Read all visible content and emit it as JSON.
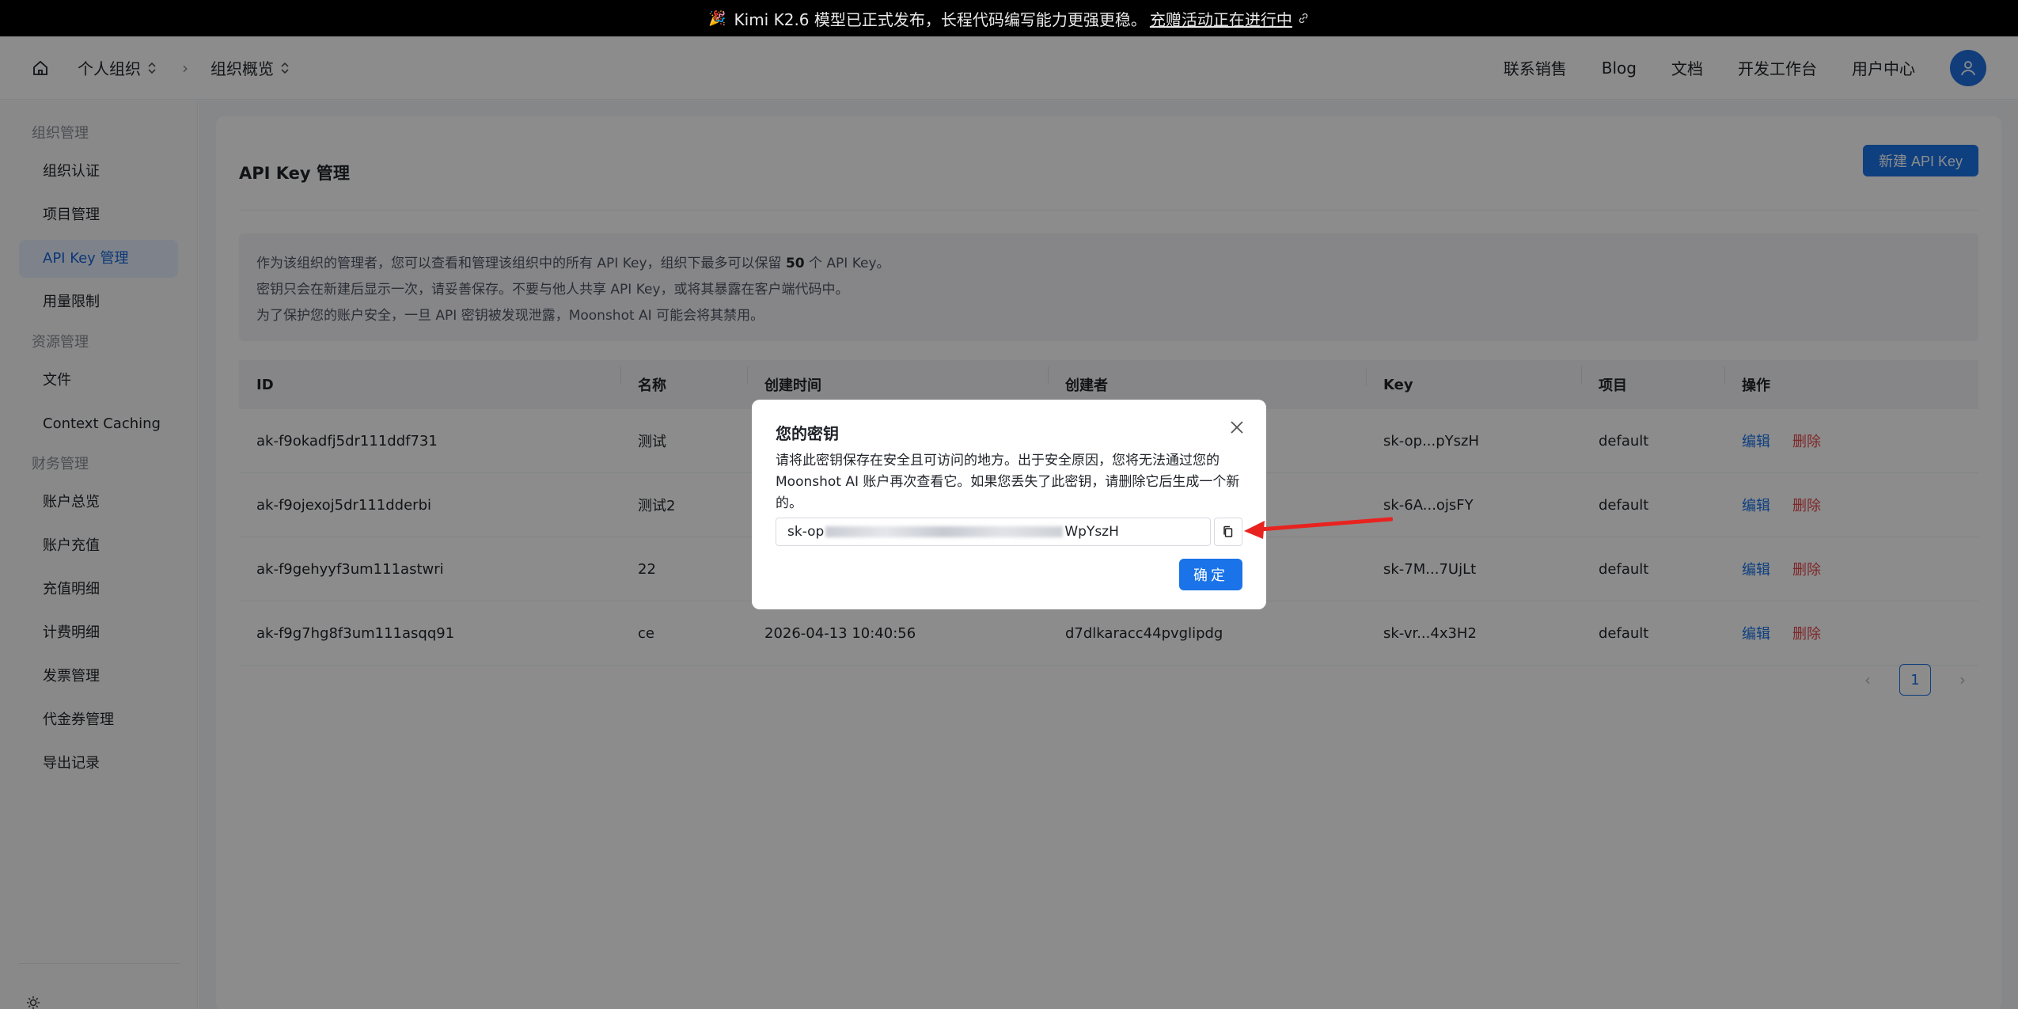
{
  "announcement": {
    "text": "Kimi K2.6 模型已正式发布，长程代码编写能力更强更稳。",
    "link": "充赠活动正在进行中"
  },
  "header": {
    "org": "个人组织",
    "section": "组织概览",
    "nav": [
      "联系销售",
      "Blog",
      "文档",
      "开发工作台",
      "用户中心"
    ]
  },
  "sidebar": {
    "groups": [
      {
        "label": "组织管理",
        "items": [
          "组织认证",
          "项目管理",
          "API Key 管理",
          "用量限制"
        ]
      },
      {
        "label": "资源管理",
        "items": [
          "文件",
          "Context Caching"
        ]
      },
      {
        "label": "财务管理",
        "items": [
          "账户总览",
          "账户充值",
          "充值明细",
          "计费明细",
          "发票管理",
          "代金券管理",
          "导出记录"
        ]
      }
    ],
    "active": "API Key 管理"
  },
  "page": {
    "title": "API Key 管理",
    "new_button": "新建 API Key",
    "notice": {
      "line1_pre": "作为该组织的管理者，您可以查看和管理该组织中的所有 API Key，组织下最多可以保留 ",
      "line1_num": "50",
      "line1_post": " 个 API Key。",
      "line2": "密钥只会在新建后显示一次，请妥善保存。不要与他人共享 API Key，或将其暴露在客户端代码中。",
      "line3": "为了保护您的账户安全，一旦 API 密钥被发现泄露，Moonshot AI 可能会将其禁用。"
    }
  },
  "table": {
    "columns": [
      "ID",
      "名称",
      "创建时间",
      "创建者",
      "Key",
      "项目",
      "操作"
    ],
    "edit_label": "编辑",
    "delete_label": "删除",
    "rows": [
      {
        "id": "ak-f9okadfj5dr111ddf731",
        "name": "测试",
        "created": "",
        "creator": "",
        "key": "sk-op...pYszH",
        "project": "default"
      },
      {
        "id": "ak-f9ojexoj5dr111dderbi",
        "name": "测试2",
        "created": "",
        "creator": "",
        "key": "sk-6A...ojsFY",
        "project": "default"
      },
      {
        "id": "ak-f9gehyyf3um111astwri",
        "name": "22",
        "created": "",
        "creator": "",
        "key": "sk-7M...7UjLt",
        "project": "default"
      },
      {
        "id": "ak-f9g7hg8f3um111asqq91",
        "name": "ce",
        "created": "2026-04-13 10:40:56",
        "creator": "d7dlkaracc44pvglipdg",
        "key": "sk-vr...4x3H2",
        "project": "default"
      }
    ]
  },
  "pagination": {
    "current": "1",
    "prev": "‹",
    "next": "›"
  },
  "modal": {
    "title": "您的密钥",
    "description": "请将此密钥保存在安全且可访问的地方。出于安全原因，您将无法通过您的 Moonshot AI 账户再次查看它。如果您丢失了此密钥，请删除它后生成一个新的。",
    "key_prefix": "sk-op",
    "key_suffix": "WpYszH",
    "ok_button": "确定"
  },
  "colors": {
    "accent": "#1a73e8",
    "danger": "#e5484d",
    "annotation_arrow": "#e8231f"
  }
}
